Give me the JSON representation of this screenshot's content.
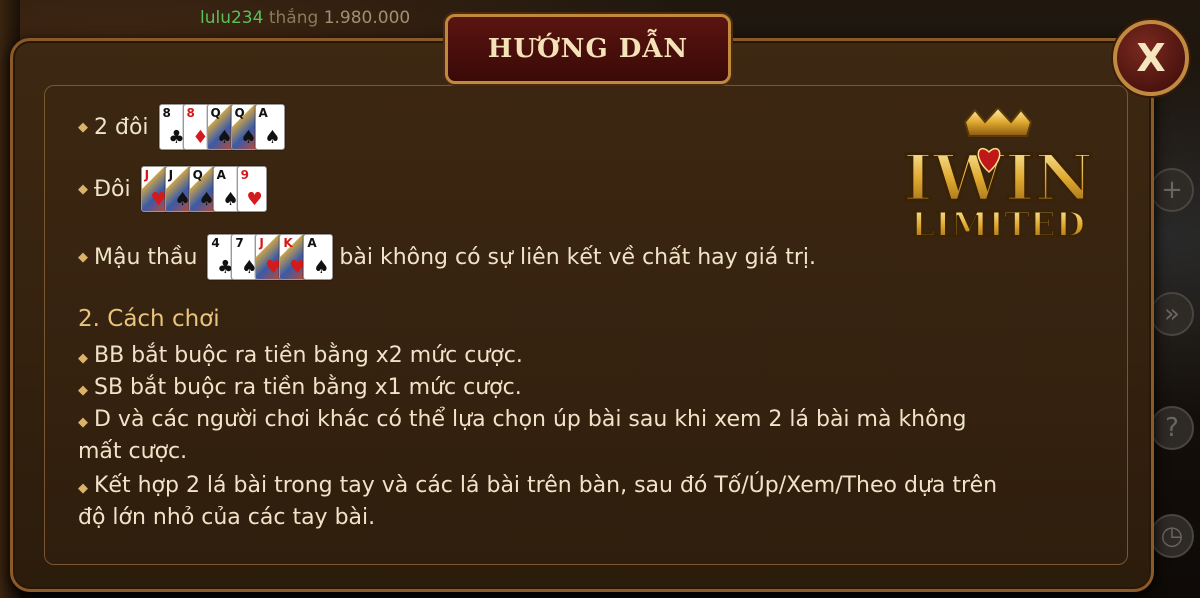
{
  "ticker": {
    "user": "lulu234",
    "verb": "thắng",
    "amount": "1.980.000"
  },
  "dialog": {
    "title": "HƯỚNG DẪN",
    "close_label": "X"
  },
  "logo": {
    "line1": "IWIN",
    "line2": "LIMITED"
  },
  "hands": [
    {
      "label": "2 đôi",
      "cards": [
        {
          "rank": "8",
          "suit": "♣"
        },
        {
          "rank": "8",
          "suit": "♦"
        },
        {
          "rank": "Q",
          "suit": "♠"
        },
        {
          "rank": "Q",
          "suit": "♠"
        },
        {
          "rank": "A",
          "suit": "♠"
        }
      ],
      "after": ""
    },
    {
      "label": "Đôi",
      "cards": [
        {
          "rank": "J",
          "suit": "♥"
        },
        {
          "rank": "J",
          "suit": "♠"
        },
        {
          "rank": "Q",
          "suit": "♠"
        },
        {
          "rank": "A",
          "suit": "♠"
        },
        {
          "rank": "9",
          "suit": "♥"
        }
      ],
      "after": ""
    },
    {
      "label": "Mậu thầu",
      "cards": [
        {
          "rank": "4",
          "suit": "♣"
        },
        {
          "rank": "7",
          "suit": "♠"
        },
        {
          "rank": "J",
          "suit": "♥"
        },
        {
          "rank": "K",
          "suit": "♥"
        },
        {
          "rank": "A",
          "suit": "♠"
        }
      ],
      "after": "bài không có sự liên kết về chất hay giá trị."
    }
  ],
  "section": {
    "title": "2. Cách chơi"
  },
  "rules": [
    "BB bắt buộc ra tiền bằng x2 mức cược.",
    "SB bắt buộc ra tiền bằng x1 mức cược.",
    "D và các người chơi khác có thể lựa chọn úp bài sau khi xem 2 lá bài mà không",
    "mất cược.",
    "Kết hợp 2 lá bài trong tay và các lá bài trên bàn, sau đó Tố/Úp/Xem/Theo dựa trên",
    "độ lớn nhỏ của các tay bài."
  ],
  "colors": {
    "accent_gold": "#c08a40",
    "panel_brown": "#3d2812",
    "title_red": "#5a1410",
    "text_cream": "#efe3c8"
  }
}
